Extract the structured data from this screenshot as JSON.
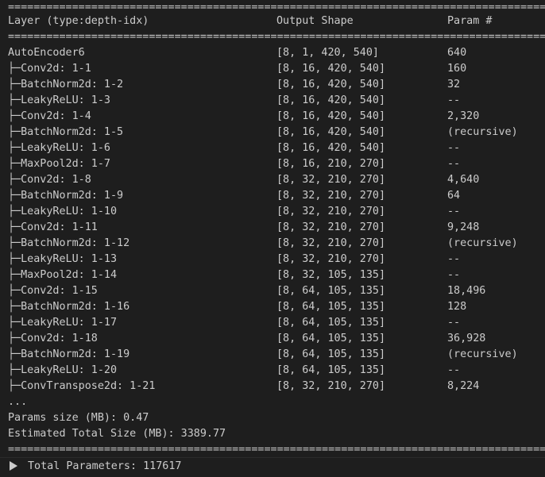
{
  "separator": "==================================================================================================================================",
  "header": {
    "layer": "Layer (type:depth-idx)",
    "output_shape": "Output Shape",
    "param": "Param #"
  },
  "root": {
    "layer": "AutoEncoder6",
    "output_shape": "[8, 1, 420, 540]",
    "param": "640"
  },
  "tree_prefix": "├─",
  "rows": [
    {
      "layer": "Conv2d: 1-1",
      "output_shape": "[8, 16, 420, 540]",
      "param": "160"
    },
    {
      "layer": "BatchNorm2d: 1-2",
      "output_shape": "[8, 16, 420, 540]",
      "param": "32"
    },
    {
      "layer": "LeakyReLU: 1-3",
      "output_shape": "[8, 16, 420, 540]",
      "param": "--"
    },
    {
      "layer": "Conv2d: 1-4",
      "output_shape": "[8, 16, 420, 540]",
      "param": "2,320"
    },
    {
      "layer": "BatchNorm2d: 1-5",
      "output_shape": "[8, 16, 420, 540]",
      "param": "(recursive)"
    },
    {
      "layer": "LeakyReLU: 1-6",
      "output_shape": "[8, 16, 420, 540]",
      "param": "--"
    },
    {
      "layer": "MaxPool2d: 1-7",
      "output_shape": "[8, 16, 210, 270]",
      "param": "--"
    },
    {
      "layer": "Conv2d: 1-8",
      "output_shape": "[8, 32, 210, 270]",
      "param": "4,640"
    },
    {
      "layer": "BatchNorm2d: 1-9",
      "output_shape": "[8, 32, 210, 270]",
      "param": "64"
    },
    {
      "layer": "LeakyReLU: 1-10",
      "output_shape": "[8, 32, 210, 270]",
      "param": "--"
    },
    {
      "layer": "Conv2d: 1-11",
      "output_shape": "[8, 32, 210, 270]",
      "param": "9,248"
    },
    {
      "layer": "BatchNorm2d: 1-12",
      "output_shape": "[8, 32, 210, 270]",
      "param": "(recursive)"
    },
    {
      "layer": "LeakyReLU: 1-13",
      "output_shape": "[8, 32, 210, 270]",
      "param": "--"
    },
    {
      "layer": "MaxPool2d: 1-14",
      "output_shape": "[8, 32, 105, 135]",
      "param": "--"
    },
    {
      "layer": "Conv2d: 1-15",
      "output_shape": "[8, 64, 105, 135]",
      "param": "18,496"
    },
    {
      "layer": "BatchNorm2d: 1-16",
      "output_shape": "[8, 64, 105, 135]",
      "param": "128"
    },
    {
      "layer": "LeakyReLU: 1-17",
      "output_shape": "[8, 64, 105, 135]",
      "param": "--"
    },
    {
      "layer": "Conv2d: 1-18",
      "output_shape": "[8, 64, 105, 135]",
      "param": "36,928"
    },
    {
      "layer": "BatchNorm2d: 1-19",
      "output_shape": "[8, 64, 105, 135]",
      "param": "(recursive)"
    },
    {
      "layer": "LeakyReLU: 1-20",
      "output_shape": "[8, 64, 105, 135]",
      "param": "--"
    },
    {
      "layer": "ConvTranspose2d: 1-21",
      "output_shape": "[8, 32, 210, 270]",
      "param": "8,224"
    }
  ],
  "ellipsis": "...",
  "params_size": "Params size (MB): 0.47",
  "estimated_total": "Estimated Total Size (MB): 3389.77",
  "footer": {
    "total_parameters": "Total Parameters: 117617",
    "expand_icon": "triangle-right-icon"
  },
  "colors": {
    "background": "#1e1e1e",
    "text": "#cccccc"
  }
}
